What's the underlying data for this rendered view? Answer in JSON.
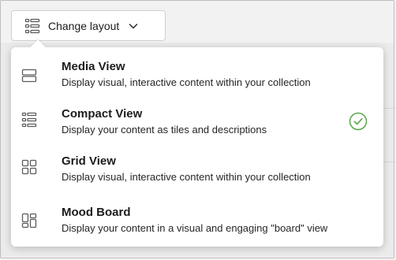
{
  "toolbar": {
    "layout_button_label": "Change layout",
    "layout_icon": "compact-list-icon",
    "dropdown_icon": "chevron-down-icon"
  },
  "menu": {
    "items": [
      {
        "title": "Media View",
        "description": "Display visual, interactive content within your collection",
        "icon": "media-view-icon",
        "selected": false
      },
      {
        "title": "Compact View",
        "description": "Display your content as tiles and descriptions",
        "icon": "compact-view-icon",
        "selected": true
      },
      {
        "title": "Grid View",
        "description": "Display visual, interactive content within your collection",
        "icon": "grid-view-icon",
        "selected": false
      },
      {
        "title": "Mood Board",
        "description": "Display your content in a visual and engaging \"board\" view",
        "icon": "mood-board-icon",
        "selected": false
      }
    ],
    "selected_icon": "check-circle-icon"
  },
  "colors": {
    "selected_check": "#5aa64a",
    "icon_stroke": "#5b5b5b"
  }
}
